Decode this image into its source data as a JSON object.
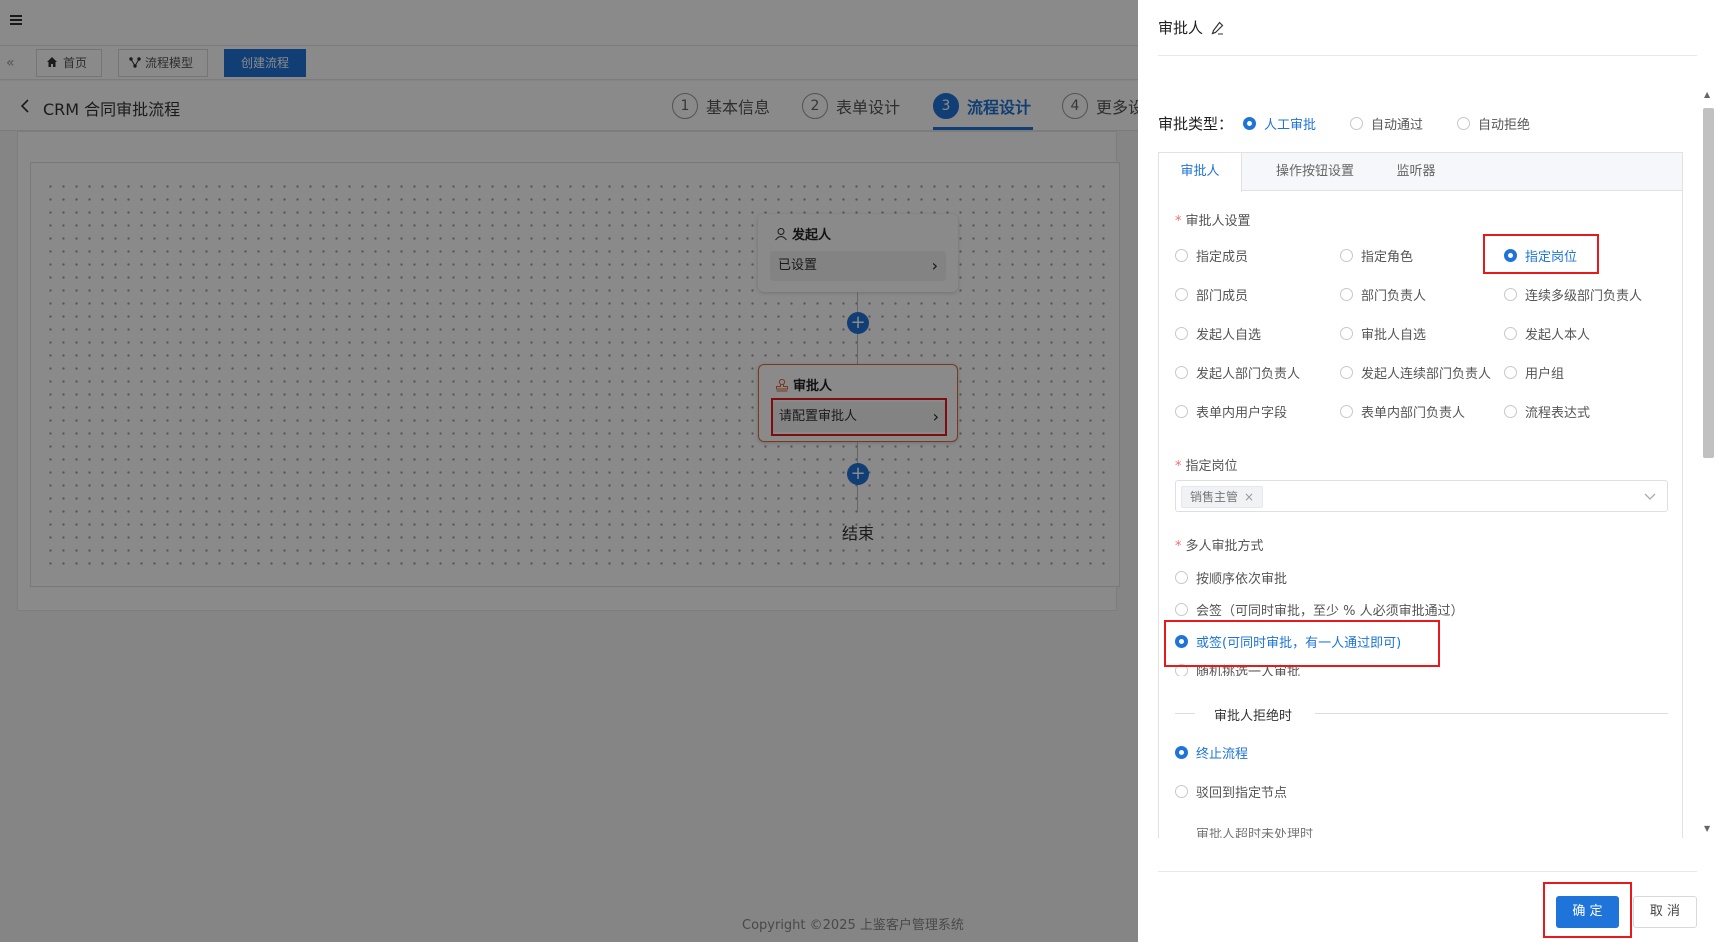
{
  "tabbar": {
    "home": "首页",
    "process_model": "流程模型",
    "create_process": "创建流程"
  },
  "header": {
    "title": "CRM 合同审批流程",
    "steps": [
      {
        "num": "1",
        "label": "基本信息"
      },
      {
        "num": "2",
        "label": "表单设计"
      },
      {
        "num": "3",
        "label": "流程设计"
      },
      {
        "num": "4",
        "label": "更多设"
      }
    ]
  },
  "canvas": {
    "initiator_title": "发起人",
    "initiator_value": "已设置",
    "approver_title": "审批人",
    "approver_value": "请配置审批人",
    "plus": "+",
    "end_label": "结束"
  },
  "footer": {
    "copyright": "Copyright ©2025 上鉴客户管理系统"
  },
  "drawer": {
    "title": "审批人",
    "approval_type_label": "审批类型：",
    "approval_types": [
      "人工审批",
      "自动通过",
      "自动拒绝"
    ],
    "tabs": [
      "审批人",
      "操作按钮设置",
      "监听器"
    ],
    "approver_settings_label": "审批人设置",
    "approver_options": [
      "指定成员",
      "指定角色",
      "指定岗位",
      "部门成员",
      "部门负责人",
      "连续多级部门负责人",
      "发起人自选",
      "审批人自选",
      "发起人本人",
      "发起人部门负责人",
      "发起人连续部门负责人",
      "用户组",
      "表单内用户字段",
      "表单内部门负责人",
      "流程表达式"
    ],
    "selected_option": "指定岗位",
    "post_label": "指定岗位",
    "post_tag": "销售主管",
    "post_tag_close": "×",
    "multi_label": "多人审批方式",
    "multi_options": [
      "按顺序依次审批",
      "会签（可同时审批，至少 % 人必须审批通过）",
      "或签(可同时审批，有一人通过即可)",
      "随机挑选一人审批"
    ],
    "reject_divider": "审批人拒绝时",
    "reject_options": [
      "终止流程",
      "驳回到指定节点"
    ],
    "cut_text": "审批人超时未处理时",
    "confirm": "确 定",
    "cancel": "取 消"
  },
  "colors": {
    "accent": "#1e74d8",
    "highlight": "#e8191b",
    "node_border": "#e06a3a"
  }
}
